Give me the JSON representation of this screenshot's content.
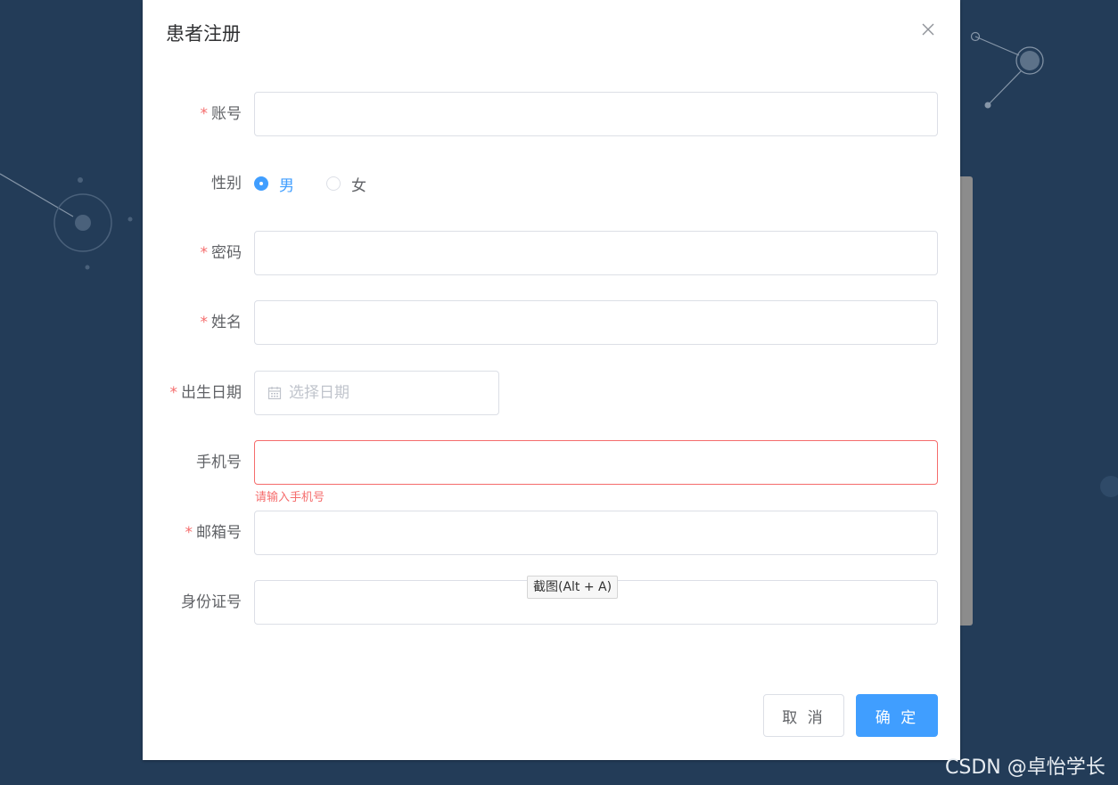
{
  "dialog": {
    "title": "患者注册",
    "close_icon": "close-icon"
  },
  "form": {
    "account": {
      "label": "账号",
      "required": true,
      "value": ""
    },
    "gender": {
      "label": "性别",
      "options": [
        {
          "label": "男",
          "checked": true
        },
        {
          "label": "女",
          "checked": false
        }
      ]
    },
    "password": {
      "label": "密码",
      "required": true,
      "value": ""
    },
    "name": {
      "label": "姓名",
      "required": true,
      "value": ""
    },
    "birth_date": {
      "label": "出生日期",
      "required": true,
      "placeholder": "选择日期",
      "icon": "calendar-icon"
    },
    "phone": {
      "label": "手机号",
      "required": false,
      "value": "",
      "error": "请输入手机号"
    },
    "email": {
      "label": "邮箱号",
      "required": true,
      "value": ""
    },
    "id_card": {
      "label": "身份证号",
      "required": false,
      "value": ""
    }
  },
  "footer": {
    "cancel_label": "取 消",
    "confirm_label": "确 定"
  },
  "tooltip": {
    "text": "截图(Alt + A)"
  },
  "watermark": {
    "text": "CSDN @卓怡学长"
  },
  "colors": {
    "background": "#233c58",
    "primary": "#409eff",
    "danger": "#f56c6c",
    "border": "#dcdfe6"
  }
}
